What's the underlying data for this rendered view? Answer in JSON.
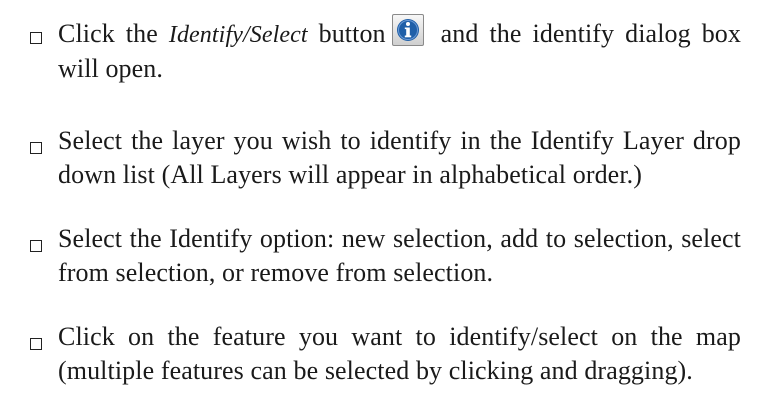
{
  "bullets": [
    {
      "pre": "Click the ",
      "italic": "Identify/Select",
      "mid": " button",
      "post": " and the identify dialog box will open.",
      "icon": "info-icon"
    },
    {
      "text": "Select the layer you wish to identify in the Identify Layer drop down list (All Layers will appear in alphabetical order.)"
    },
    {
      "text": "Select the Identify option: new selection, add to selection, select from selection, or remove from selection."
    },
    {
      "text": "Click on the feature you want to identify/select on the map (multiple features can be selected by clicking and dragging)."
    }
  ]
}
